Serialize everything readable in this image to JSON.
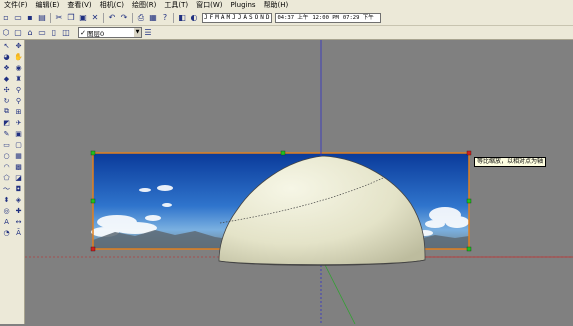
{
  "menu": {
    "items": [
      "文件(F)",
      "编辑(E)",
      "查看(V)",
      "相机(C)",
      "绘图(R)",
      "工具(T)",
      "窗口(W)",
      "Plugins",
      "帮助(H)"
    ]
  },
  "toolbar": {
    "months": [
      "J",
      "F",
      "M",
      "A",
      "M",
      "J",
      "J",
      "A",
      "S",
      "O",
      "N",
      "D"
    ],
    "times": [
      "04:37 上午",
      "12:00 PM",
      "07:29 下午"
    ]
  },
  "layer": {
    "check": "✓",
    "name": "图层0"
  },
  "tooltip": {
    "text": "等比缩放，以相对点为轴"
  },
  "colors": {
    "viewport_bg": "#808080",
    "axis_red": "#b03030",
    "axis_blue": "#3030c8",
    "axis_green": "#30a030",
    "selection_orange": "#e08020",
    "handle_green": "#20c020",
    "handle_red": "#d02020"
  },
  "icons": [
    "new-file-icon",
    "open-icon",
    "save-icon",
    "print-icon",
    "cut-icon",
    "copy-icon",
    "paste-icon",
    "delete-icon",
    "undo-icon",
    "redo-icon",
    "print2-icon",
    "model-info-icon",
    "help-icon"
  ]
}
